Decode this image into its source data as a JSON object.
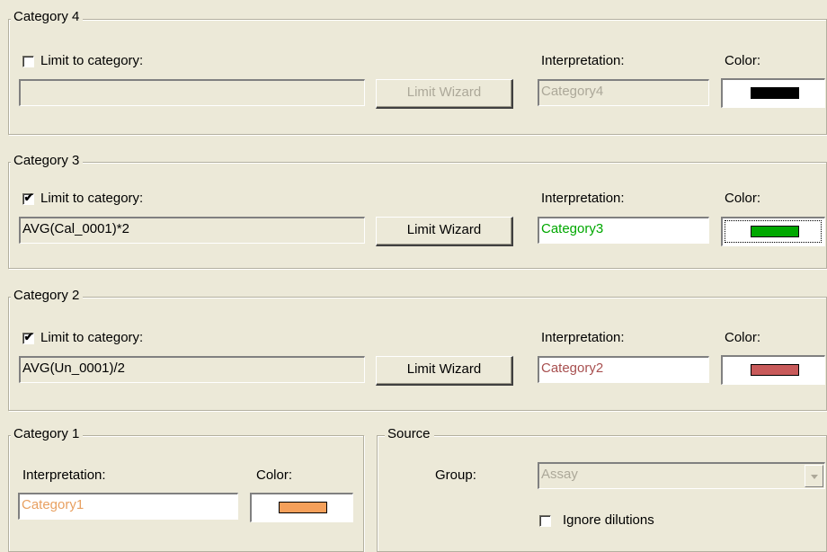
{
  "category4": {
    "title": "Category 4",
    "limit_label": "Limit to category:",
    "limit_checked": false,
    "limit_value": "",
    "wizard_label": "Limit Wizard",
    "interp_label": "Interpretation:",
    "interp_value": "Category4",
    "color_label": "Color:",
    "color": "#000000",
    "text_color": "#aca899"
  },
  "category3": {
    "title": "Category 3",
    "limit_label": "Limit to category:",
    "limit_checked": true,
    "limit_value": "AVG(Cal_0001)*2",
    "wizard_label": "Limit Wizard",
    "interp_label": "Interpretation:",
    "interp_value": "Category3",
    "color_label": "Color:",
    "color": "#00a800",
    "text_color": "#00a800"
  },
  "category2": {
    "title": "Category 2",
    "limit_label": "Limit to category:",
    "limit_checked": true,
    "limit_value": "AVG(Un_0001)/2",
    "wizard_label": "Limit Wizard",
    "interp_label": "Interpretation:",
    "interp_value": "Category2",
    "color_label": "Color:",
    "color": "#c85a5a",
    "text_color": "#a85050"
  },
  "category1": {
    "title": "Category 1",
    "interp_label": "Interpretation:",
    "interp_value": "Category1",
    "color_label": "Color:",
    "color": "#f5a05a",
    "text_color": "#e8a060"
  },
  "source": {
    "title": "Source",
    "group_label": "Group:",
    "group_value": "Assay",
    "ignore_label": "Ignore dilutions",
    "ignore_checked": false
  },
  "check_glyph": "✔"
}
